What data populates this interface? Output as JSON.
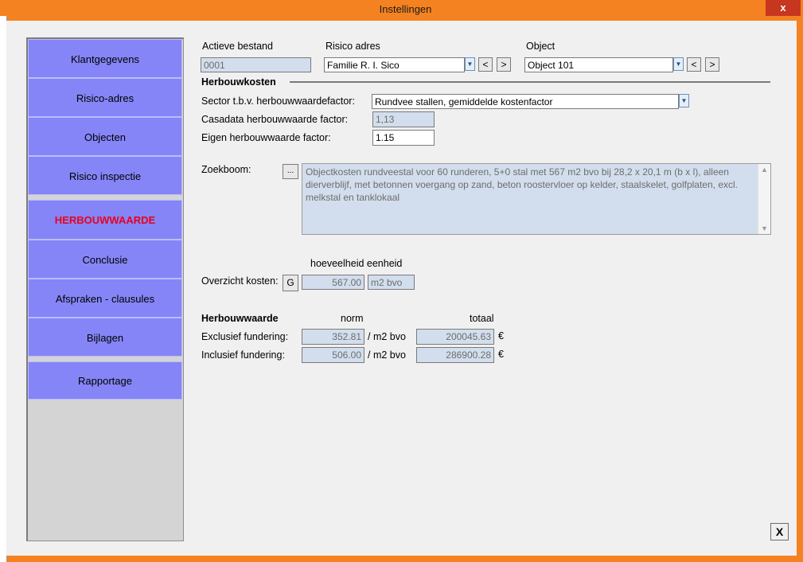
{
  "window": {
    "title": "Instellingen",
    "close_glyph": "x"
  },
  "nav": {
    "items": [
      {
        "label": "Klantgegevens"
      },
      {
        "label": "Risico-adres"
      },
      {
        "label": "Objecten"
      },
      {
        "label": "Risico inspectie"
      },
      {
        "label": "HERBOUWWAARDE"
      },
      {
        "label": "Conclusie"
      },
      {
        "label": "Afspraken - clausules"
      },
      {
        "label": "Bijlagen"
      },
      {
        "label": "Rapportage"
      }
    ],
    "active": "HERBOUWWAARDE"
  },
  "header": {
    "actieve_bestand_label": "Actieve bestand",
    "actieve_bestand_value": "0001",
    "risico_adres_label": "Risico adres",
    "risico_adres_value": "Familie R. I. Sico",
    "object_label": "Object",
    "object_value": "Object 101",
    "prev": "<",
    "next": ">"
  },
  "herbouwkosten": {
    "section_title": "Herbouwkosten",
    "sector_label": "Sector t.b.v. herbouwwaardefactor:",
    "sector_value": "Rundvee stallen, gemiddelde kostenfactor",
    "casadata_label": "Casadata herbouwwaarde factor:",
    "casadata_value": "1,13",
    "eigen_label": "Eigen herbouwwaarde factor:",
    "eigen_value": "1.15",
    "zoekboom_label": "Zoekboom:",
    "zoekboom_button": "...",
    "zoekboom_text": "Objectkosten rundveestal voor 60 runderen, 5+0 stal met 567 m2 bvo bij 28,2 x 20,1 m (b x l), alleen dierverblijf, met betonnen voergang op zand, beton roostervloer op kelder, staalskelet, golfplaten, excl. melkstal en tanklokaal"
  },
  "overzicht": {
    "col_header": "hoeveelheid eenheid",
    "label": "Overzicht kosten:",
    "button": "G",
    "hoeveelheid": "567.00",
    "eenheid": "m2 bvo"
  },
  "herbouwwaarde": {
    "title": "Herbouwwaarde",
    "norm_header": "norm",
    "totaal_header": "totaal",
    "rows": [
      {
        "label": "Exclusief fundering:",
        "norm": "352.81",
        "unit": "/ m2 bvo",
        "totaal": "200045.63",
        "currency": "€"
      },
      {
        "label": "Inclusief fundering:",
        "norm": "506.00",
        "unit": "/ m2 bvo",
        "totaal": "286900.28",
        "currency": "€"
      }
    ]
  },
  "footer": {
    "close_label": "X"
  },
  "colors": {
    "titlebar": "#f58220",
    "nav_button": "#8585f7",
    "active_nav_text": "#e8001c",
    "readonly_field": "#d2deed",
    "close_button": "#c7361f"
  }
}
